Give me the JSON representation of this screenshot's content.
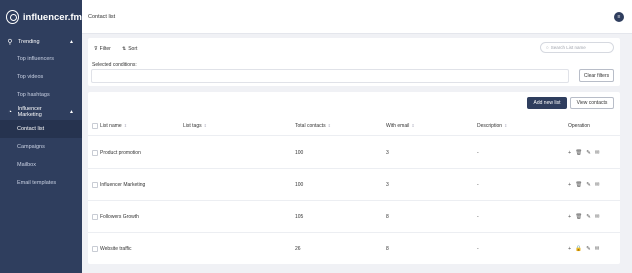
{
  "brand": {
    "name": "influencer.fm"
  },
  "sidebar": {
    "groups": [
      {
        "label": "Trending",
        "items": [
          "Top influencers",
          "Top videos",
          "Top hashtags"
        ]
      },
      {
        "label": "Influencer Marketing",
        "items": [
          "Contact list",
          "Campaigns",
          "Mailbox",
          "Email templates"
        ]
      }
    ],
    "active_item": "Contact list"
  },
  "topbar": {
    "title": "Contact list"
  },
  "filters": {
    "filter_label": "Filter",
    "sort_label": "Sort",
    "search_placeholder": "Search List name",
    "conditions_label": "Selected conditions:",
    "clear_label": "Clear filters"
  },
  "actions": {
    "add_label": "Add new list",
    "view_label": "View contacts"
  },
  "table": {
    "columns": [
      "List name",
      "List tags",
      "Total contacts",
      "With email",
      "Description",
      "Operation"
    ],
    "rows": [
      {
        "name": "Product promotion",
        "tags": "",
        "total": "100",
        "with_email": "3",
        "description": "-"
      },
      {
        "name": "Influencer Marketing",
        "tags": "",
        "total": "100",
        "with_email": "3",
        "description": "-"
      },
      {
        "name": "Followers Growth",
        "tags": "",
        "total": "105",
        "with_email": "8",
        "description": "-"
      },
      {
        "name": "Website traffic",
        "tags": "",
        "total": "26",
        "with_email": "8",
        "description": "-"
      }
    ]
  }
}
